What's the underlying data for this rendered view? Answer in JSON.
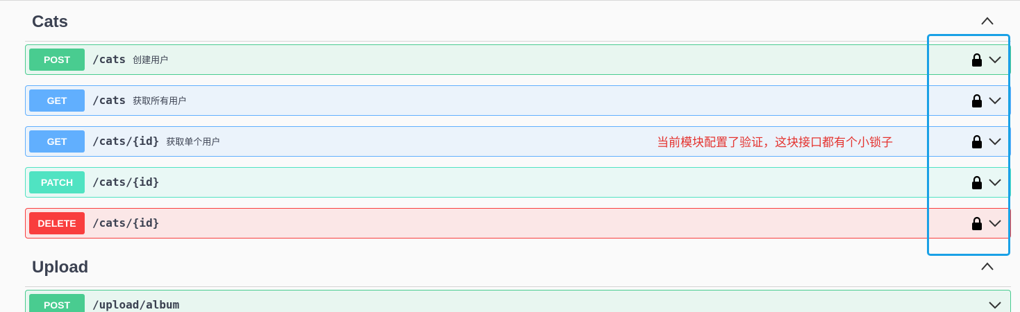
{
  "sections": [
    {
      "title": "Cats",
      "toggle_icon": "chevron-up-icon",
      "operations": [
        {
          "method": "POST",
          "kind": "post",
          "path": "/cats",
          "summary": "创建用户",
          "locked": true
        },
        {
          "method": "GET",
          "kind": "get",
          "path": "/cats",
          "summary": "获取所有用户",
          "locked": true
        },
        {
          "method": "GET",
          "kind": "get",
          "path": "/cats/{id}",
          "summary": "获取单个用户",
          "locked": true
        },
        {
          "method": "PATCH",
          "kind": "patch",
          "path": "/cats/{id}",
          "summary": "",
          "locked": true
        },
        {
          "method": "DELETE",
          "kind": "delete",
          "path": "/cats/{id}",
          "summary": "",
          "locked": true
        }
      ]
    },
    {
      "title": "Upload",
      "toggle_icon": "chevron-up-icon",
      "operations": [
        {
          "method": "POST",
          "kind": "post",
          "path": "/upload/album",
          "summary": "",
          "locked": false
        }
      ]
    }
  ],
  "annotation": {
    "text": "当前模块配置了验证，这块接口都有个小锁子",
    "color": "#e4332f",
    "highlight_color": "#1aa1e6"
  },
  "colors": {
    "post": "#49cc90",
    "get": "#61affe",
    "patch": "#50e3c2",
    "delete": "#f93e3e"
  }
}
